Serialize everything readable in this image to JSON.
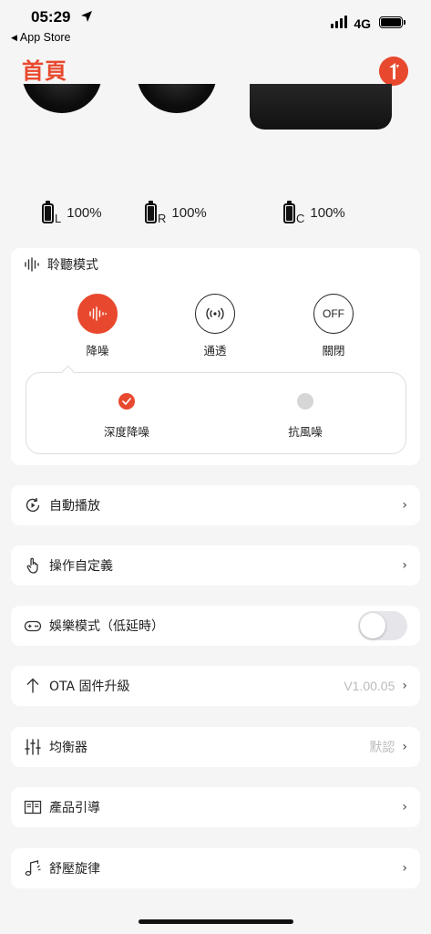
{
  "status_bar": {
    "time": "05:29",
    "network": "4G",
    "back_app": "App Store"
  },
  "header": {
    "title": "首頁"
  },
  "batteries": [
    {
      "side": "L",
      "percent": "100%"
    },
    {
      "side": "R",
      "percent": "100%"
    },
    {
      "side": "C",
      "percent": "100%"
    }
  ],
  "listening": {
    "title": "聆聽模式",
    "modes": [
      {
        "label": "降噪",
        "icon_text": "",
        "active": true
      },
      {
        "label": "通透",
        "icon_text": "",
        "active": false
      },
      {
        "label": "關閉",
        "icon_text": "OFF",
        "active": false
      }
    ],
    "sub_options": [
      {
        "label": "深度降噪",
        "selected": true
      },
      {
        "label": "抗風噪",
        "selected": false
      }
    ]
  },
  "settings": [
    {
      "label": "自動播放",
      "value": "",
      "icon": "autoplay-icon"
    },
    {
      "label": "操作自定義",
      "value": "",
      "icon": "touch-gesture-icon"
    },
    {
      "label": "娛樂模式（低延時）",
      "value": "",
      "icon": "gamepad-icon",
      "toggle": false
    },
    {
      "label": "OTA 固件升級",
      "value": "V1.00.05",
      "icon": "upgrade-arrow-icon"
    },
    {
      "label": "均衡器",
      "value": "默認",
      "icon": "equalizer-icon"
    },
    {
      "label": "產品引導",
      "value": "",
      "icon": "guide-book-icon"
    },
    {
      "label": "舒壓旋律",
      "value": "",
      "icon": "music-note-icon"
    }
  ],
  "colors": {
    "accent": "#e8492e",
    "background": "#f5f5f5"
  }
}
